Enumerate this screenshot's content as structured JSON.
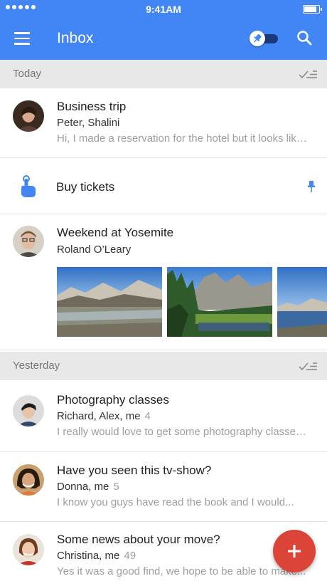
{
  "status_bar": {
    "time": "9:41AM"
  },
  "app_bar": {
    "title": "Inbox"
  },
  "sections": [
    {
      "label": "Today"
    },
    {
      "label": "Yesterday"
    }
  ],
  "today_items": {
    "business_trip": {
      "subject": "Business trip",
      "senders": "Peter, Shalini",
      "snippet": "Hi, I made a reservation for the hotel but it looks like..."
    },
    "reminder": {
      "title": "Buy tickets"
    },
    "yosemite": {
      "subject": "Weekend at Yosemite",
      "senders": "Roland O’Leary"
    }
  },
  "yesterday_items": [
    {
      "subject": "Photography classes",
      "senders": "Richard, Alex, me",
      "count": "4",
      "snippet": "I really would love to get some photography classes..."
    },
    {
      "subject": "Have you seen this tv-show?",
      "senders": "Donna, me",
      "count": "5",
      "snippet": "I know you guys have read the book and I would..."
    },
    {
      "subject": "Some news about your move?",
      "senders": "Christina, me",
      "count": "49",
      "snippet": "Yes it was a good find, we hope to be able to make..."
    }
  ],
  "colors": {
    "primary": "#4285f4",
    "fab": "#db4437",
    "section_bg": "#e8e8e8"
  },
  "icons": [
    "menu-icon",
    "pin-toggle",
    "search-icon",
    "sweep-icon",
    "reminder-icon",
    "pin-icon",
    "compose-icon"
  ]
}
